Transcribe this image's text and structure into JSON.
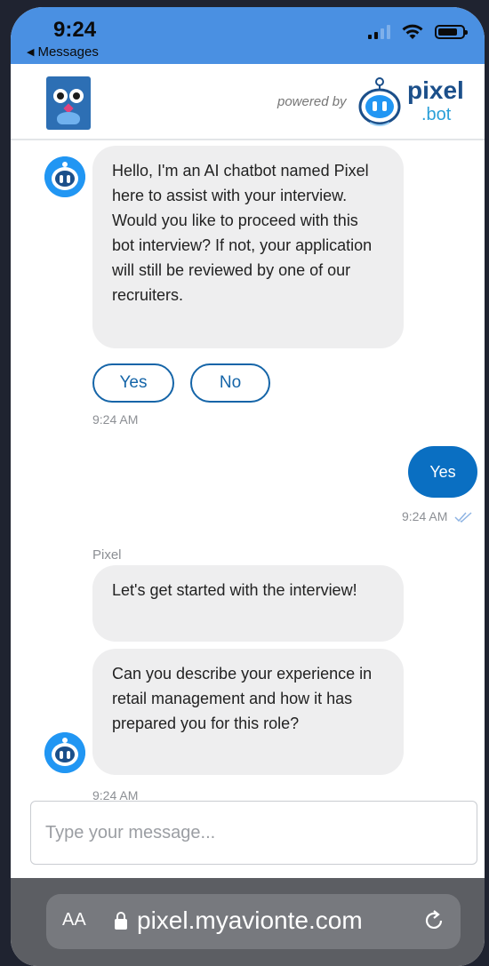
{
  "status_bar": {
    "time": "9:24",
    "back_label": "Messages"
  },
  "header": {
    "powered_by": "powered by",
    "brand_name": "pixel",
    "brand_suffix": ".bot"
  },
  "chat": {
    "messages": [
      {
        "from": "bot",
        "text": "Hello, I'm an AI chatbot named Pixel here to assist with your interview. Would you like to proceed with this bot interview? If not, your application will still be reviewed by one of our recruiters."
      },
      {
        "from": "user",
        "text": "Yes"
      },
      {
        "from": "bot",
        "text": "Let's get started with the interview!"
      },
      {
        "from": "bot",
        "text": "Can you describe your experience in retail management and how it has prepared you for this role?"
      }
    ],
    "quick_replies": [
      "Yes",
      "No"
    ],
    "timestamps": [
      "9:24 AM",
      "9:24 AM",
      "9:24 AM"
    ],
    "sender_name": "Pixel"
  },
  "input": {
    "placeholder": "Type your message...",
    "value": ""
  },
  "browser": {
    "aa_label": "AA",
    "url": "pixel.myavionte.com"
  },
  "colors": {
    "accent": "#0a6fc2",
    "status_bar": "#4a90e2",
    "bubble_bot": "#eeeeef",
    "chip_border": "#1565a8"
  }
}
